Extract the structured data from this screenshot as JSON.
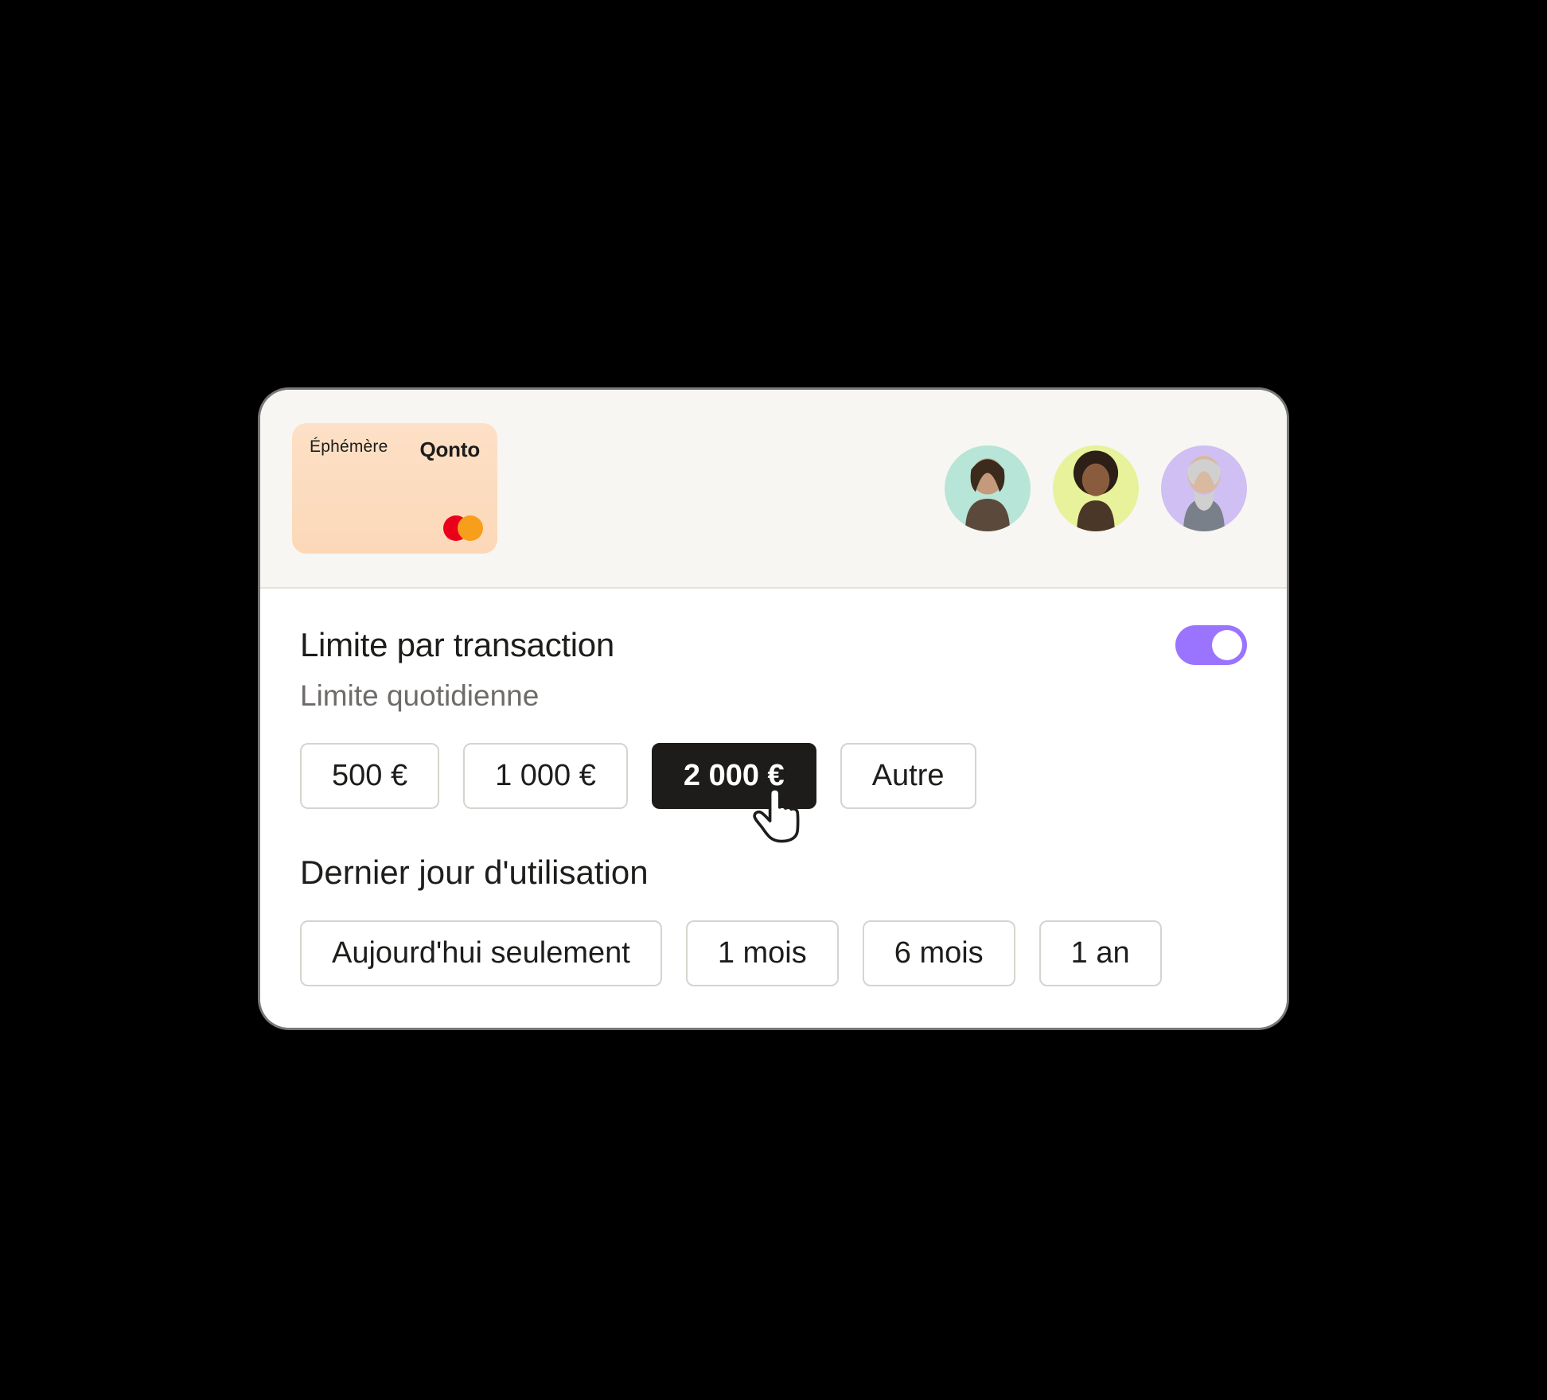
{
  "card": {
    "type_label": "Éphémère",
    "brand": "Qonto"
  },
  "avatars": [
    "user-1",
    "user-2",
    "user-3"
  ],
  "transaction_limit": {
    "title": "Limite par transaction",
    "subtitle": "Limite quotidienne",
    "toggle_on": true,
    "options": [
      {
        "label": "500 €",
        "selected": false
      },
      {
        "label": "1 000 €",
        "selected": false
      },
      {
        "label": "2 000 €",
        "selected": true
      },
      {
        "label": "Autre",
        "selected": false
      }
    ]
  },
  "last_usage": {
    "title": "Dernier jour d'utilisation",
    "options": [
      {
        "label": "Aujourd'hui seulement",
        "selected": false
      },
      {
        "label": "1 mois",
        "selected": false
      },
      {
        "label": "6 mois",
        "selected": false
      },
      {
        "label": "1 an",
        "selected": false
      }
    ]
  },
  "colors": {
    "accent": "#9a74ff",
    "text": "#1d1d1b",
    "muted": "#6e6b68"
  }
}
